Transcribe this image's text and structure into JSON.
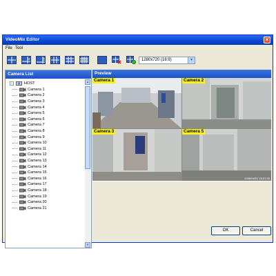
{
  "window": {
    "title": "VideoMix Editor"
  },
  "menu": {
    "file": "File",
    "tool": "Tool"
  },
  "toolbar": {
    "buttons": [
      "layout-1x1",
      "layout-1-plus-5",
      "layout-1-plus-7",
      "layout-2x2",
      "layout-3x3",
      "layout-4x4",
      "layout-clear",
      "layout-delete",
      "layout-settings"
    ],
    "resolution": "1280x720 (16:9)"
  },
  "camera_list": {
    "title": "Camera List",
    "host": "HOST",
    "items": [
      "Camera 1",
      "Camera 2",
      "Camera 3",
      "Camera 4",
      "Camera 5",
      "Camera 6",
      "Camera 7",
      "Camera 8",
      "Camera 9",
      "Camera 10",
      "Camera 11",
      "Camera 12",
      "Camera 13",
      "Camera 14",
      "Camera 15",
      "Camera 16",
      "Camera 17",
      "Camera 18",
      "Camera 19",
      "Camera 20",
      "Camera 21"
    ]
  },
  "preview": {
    "title": "Preview",
    "cameras": [
      "Camera 1",
      "Camera 2",
      "Camera 3",
      "Camera 5"
    ],
    "timestamp": "2008/04/01 15:21:25"
  },
  "buttons": {
    "ok": "OK",
    "cancel": "Cancel"
  }
}
